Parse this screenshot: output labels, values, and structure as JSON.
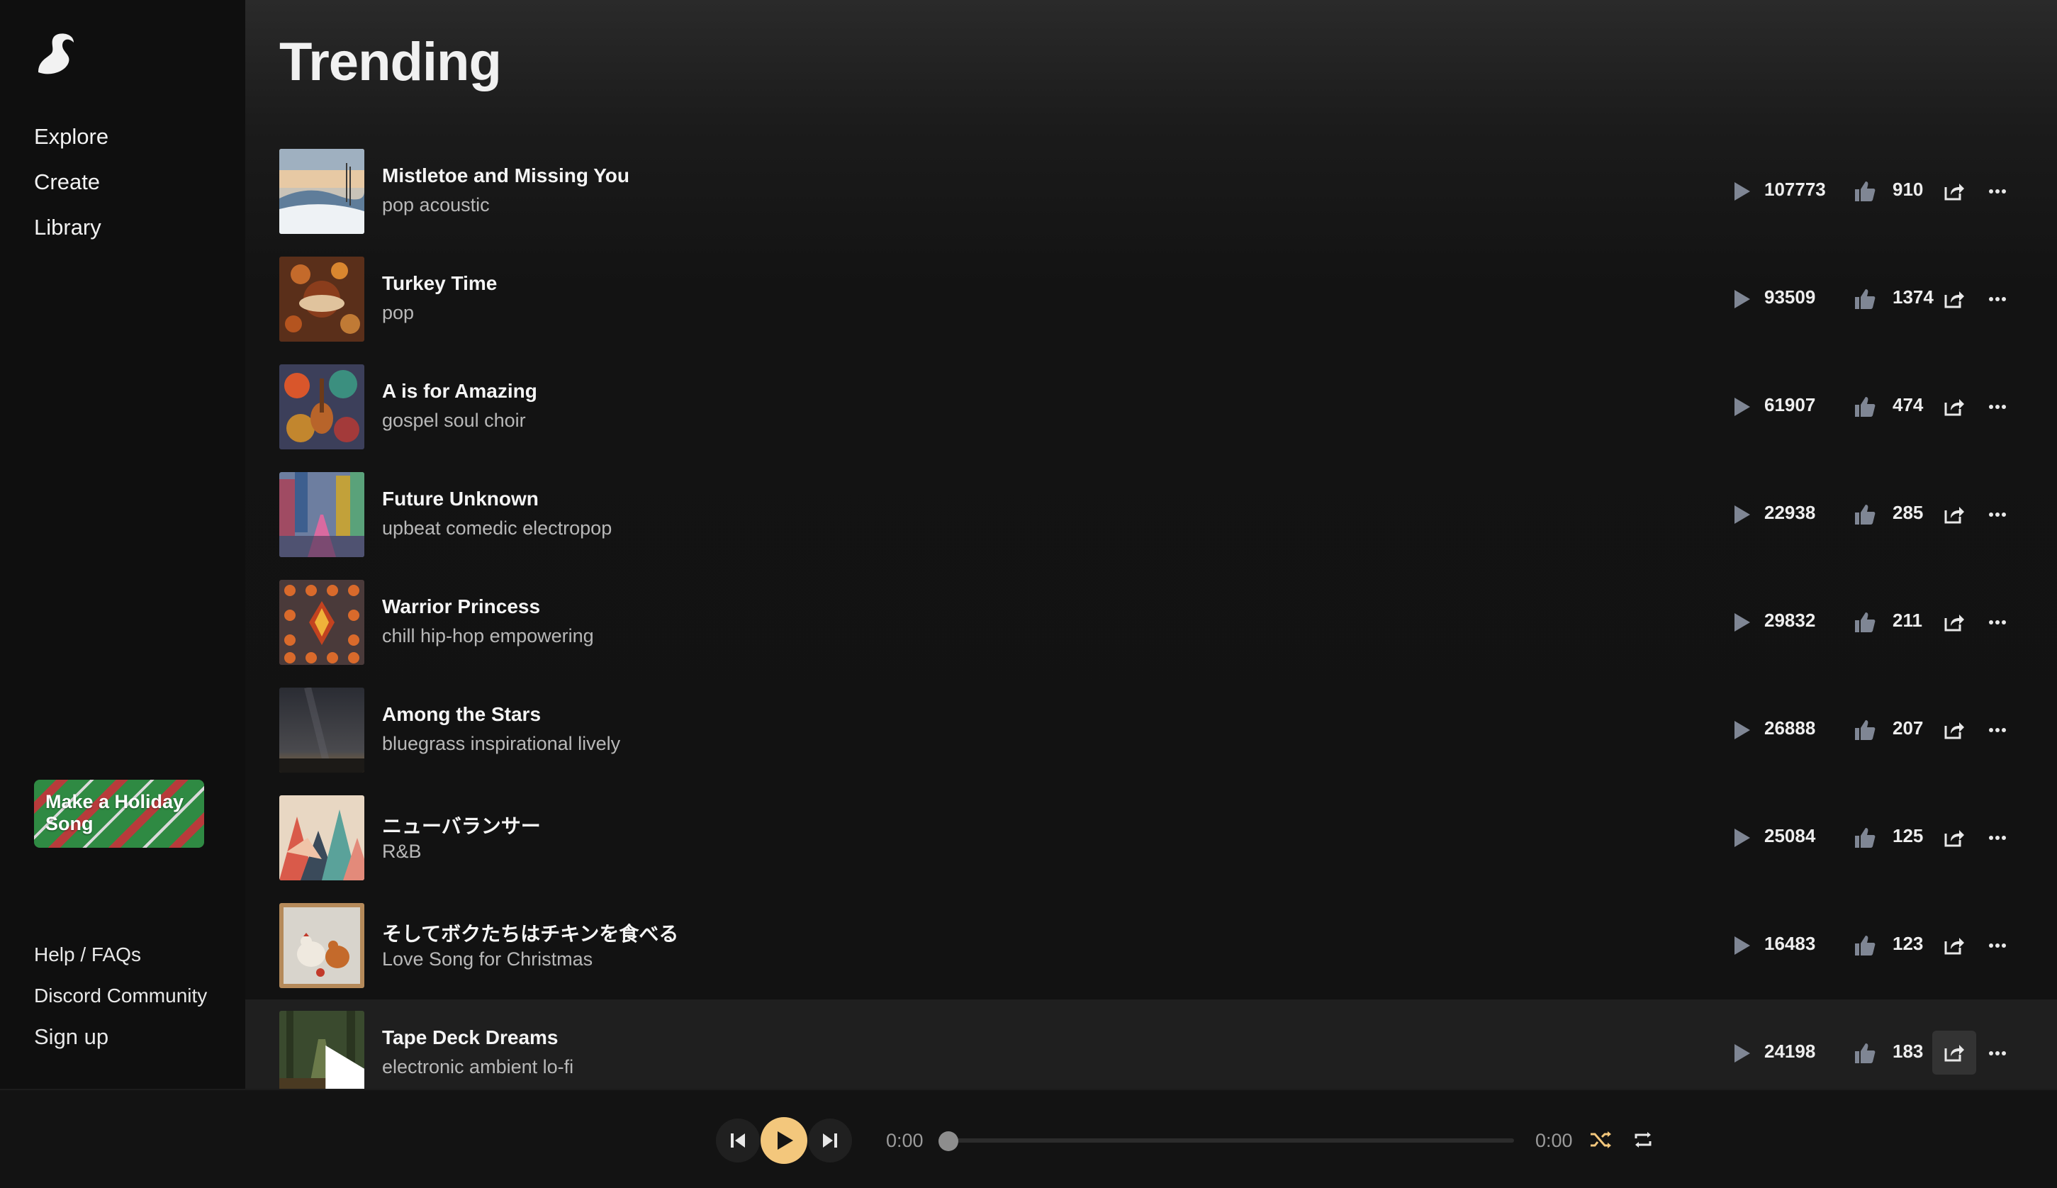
{
  "app": {
    "accent_color": "#f3c77c",
    "brand_icon": "suno-wave-logo"
  },
  "sidebar": {
    "nav": [
      {
        "label": "Explore"
      },
      {
        "label": "Create"
      },
      {
        "label": "Library"
      }
    ],
    "promo_label": "Make a Holiday Song",
    "footer": [
      {
        "label": "Help / FAQs"
      },
      {
        "label": "Discord Community"
      },
      {
        "label": "Sign up"
      }
    ]
  },
  "page": {
    "title": "Trending"
  },
  "songs": [
    {
      "title": "Mistletoe and Missing You",
      "tags": "pop acoustic",
      "plays": "107773",
      "likes": "910"
    },
    {
      "title": "Turkey Time",
      "tags": "pop",
      "plays": "93509",
      "likes": "1374"
    },
    {
      "title": "A is for Amazing",
      "tags": "gospel soul choir",
      "plays": "61907",
      "likes": "474"
    },
    {
      "title": "Future Unknown",
      "tags": "upbeat comedic electropop",
      "plays": "22938",
      "likes": "285"
    },
    {
      "title": "Warrior Princess",
      "tags": "chill hip-hop empowering",
      "plays": "29832",
      "likes": "211"
    },
    {
      "title": "Among the Stars",
      "tags": "bluegrass inspirational lively",
      "plays": "26888",
      "likes": "207"
    },
    {
      "title": "ニューバランサー",
      "tags": "R&B",
      "plays": "25084",
      "likes": "125"
    },
    {
      "title": "そしてボクたちはチキンを食べる",
      "tags": "Love Song for Christmas",
      "plays": "16483",
      "likes": "123"
    },
    {
      "title": "Tape Deck Dreams",
      "tags": "electronic ambient lo-fi",
      "plays": "24198",
      "likes": "183"
    }
  ],
  "player": {
    "current_time": "0:00",
    "duration": "0:00",
    "progress": 0,
    "shuffle_color": "#f3c77c"
  }
}
